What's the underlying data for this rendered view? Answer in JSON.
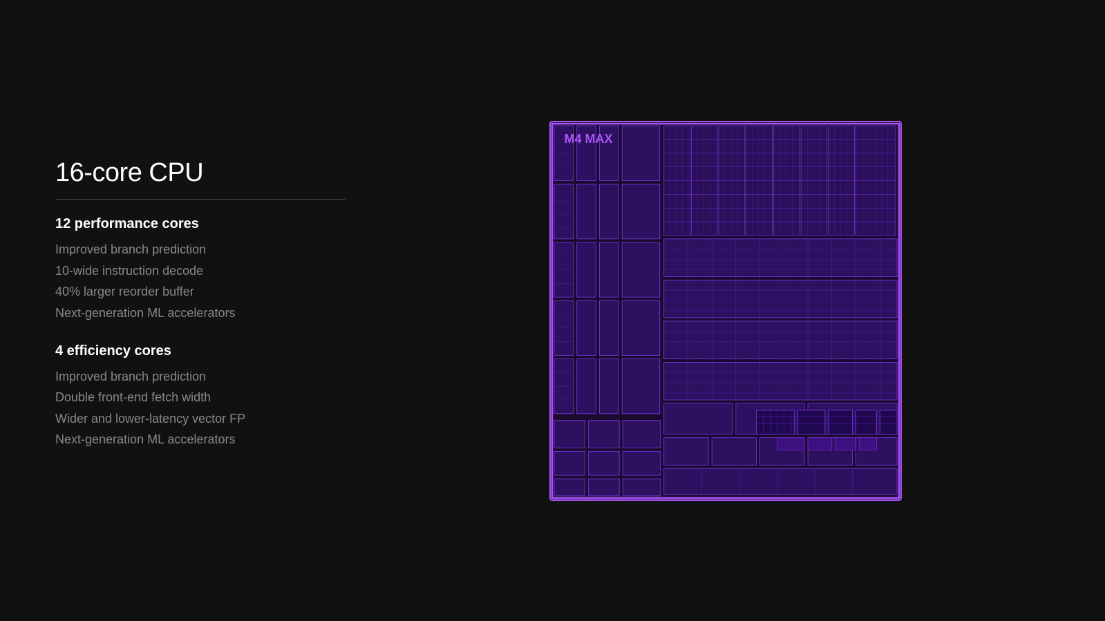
{
  "page": {
    "background_color": "#111111"
  },
  "left": {
    "cpu_title": "16-core CPU",
    "divider": true,
    "sections": [
      {
        "heading": "12 performance cores",
        "items": [
          "Improved branch prediction",
          "10-wide instruction decode",
          "40% larger reorder buffer",
          "Next-generation ML accelerators"
        ]
      },
      {
        "heading": "4 efficiency cores",
        "items": [
          "Improved branch prediction",
          "Double front-end fetch width",
          "Wider and lower-latency vector FP",
          "Next-generation ML accelerators"
        ]
      }
    ]
  },
  "chip": {
    "label": "M4 MAX",
    "apple_symbol": ""
  }
}
